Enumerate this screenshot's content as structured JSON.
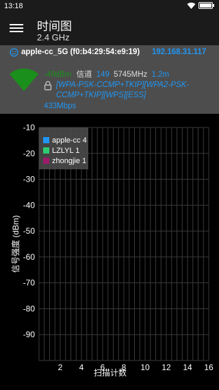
{
  "status_bar": {
    "time": "13:18"
  },
  "app_bar": {
    "title": "时间图",
    "subtitle": "2.4 GHz"
  },
  "access_point": {
    "ssid": "apple-cc_5G (f0:b4:29:54:e9:19)",
    "ip": "192.168.31.117",
    "signal": "-49dBm",
    "channel_label": "信道",
    "channel": "149",
    "frequency": "5745MHz",
    "distance": "1.2m",
    "security": "[WPA-PSK-CCMP+TKIP][WPA2-PSK-CCMP+TKIP][WPS][ESS]",
    "speed": "433Mbps"
  },
  "chart_data": {
    "type": "line",
    "ylabel": "信号强度 (dBm)",
    "xlabel": "扫描计数",
    "y_ticks": [
      "-10",
      "-20",
      "-30",
      "-40",
      "-50",
      "-60",
      "-70",
      "-80",
      "-90"
    ],
    "x_ticks": [
      "2",
      "4",
      "6",
      "8",
      "10",
      "12",
      "14",
      "16"
    ],
    "ylim": [
      -100,
      -10
    ],
    "xlim": [
      0,
      16
    ],
    "grid": true,
    "legend_placement": "top-left",
    "series": [
      {
        "name": "apple-cc 4",
        "color": "#2196f3",
        "values": []
      },
      {
        "name": "LZLYL 1",
        "color": "#2ecc71",
        "values": []
      },
      {
        "name": "zhongjie 1",
        "color": "#9c1b6b",
        "values": []
      }
    ]
  }
}
